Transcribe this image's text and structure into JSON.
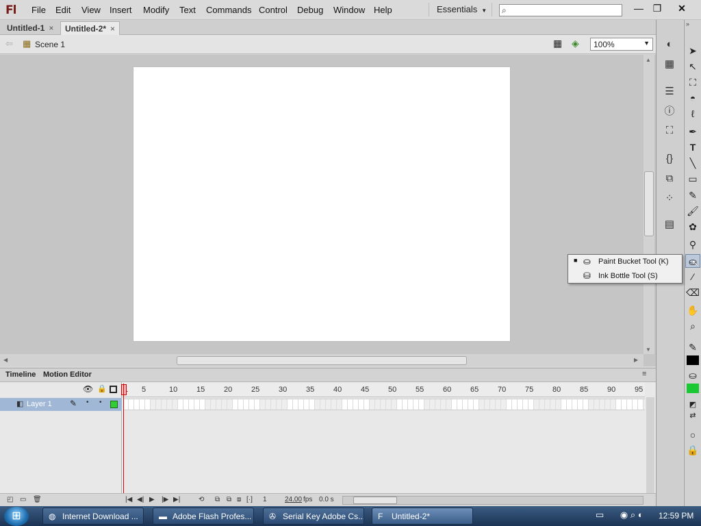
{
  "app": {
    "logo": "Fl"
  },
  "menubar": {
    "items": [
      "File",
      "Edit",
      "View",
      "Insert",
      "Modify",
      "Text",
      "Commands",
      "Control",
      "Debug",
      "Window",
      "Help"
    ],
    "workspace": "Essentials",
    "search_placeholder": ""
  },
  "window_controls": {
    "minimize": "—",
    "restore": "❐",
    "close": "✕"
  },
  "doc_tabs": [
    {
      "label": "Untitled-1",
      "close": "×"
    },
    {
      "label": "Untitled-2*",
      "close": "×"
    }
  ],
  "edit_bar": {
    "scene": "Scene 1",
    "zoom": "100%"
  },
  "timeline": {
    "tabs": [
      "Timeline",
      "Motion Editor"
    ],
    "layer": {
      "name": "Layer 1"
    },
    "ruler": [
      "5",
      "10",
      "15",
      "20",
      "25",
      "30",
      "35",
      "40",
      "45",
      "50",
      "55",
      "60",
      "65",
      "70",
      "75",
      "80",
      "85",
      "90",
      "95"
    ],
    "current_frame_marker": "1",
    "footer": {
      "frame": "1",
      "fps": "24.00",
      "fps_unit": "fps",
      "time": "0.0 s"
    }
  },
  "popup": {
    "items": [
      {
        "label": "Paint Bucket Tool (K)",
        "selected": true
      },
      {
        "label": "Ink Bottle Tool (S)",
        "selected": false
      }
    ]
  },
  "colors": {
    "stroke": "#000000",
    "fill": "#19c832",
    "layer_color": "#33cc33"
  },
  "taskbar": {
    "tasks": [
      "Internet Download ...",
      "Adobe Flash Profes...",
      "Serial Key Adobe Cs...",
      "Untitled-2*"
    ],
    "clock": "12:59 PM"
  }
}
